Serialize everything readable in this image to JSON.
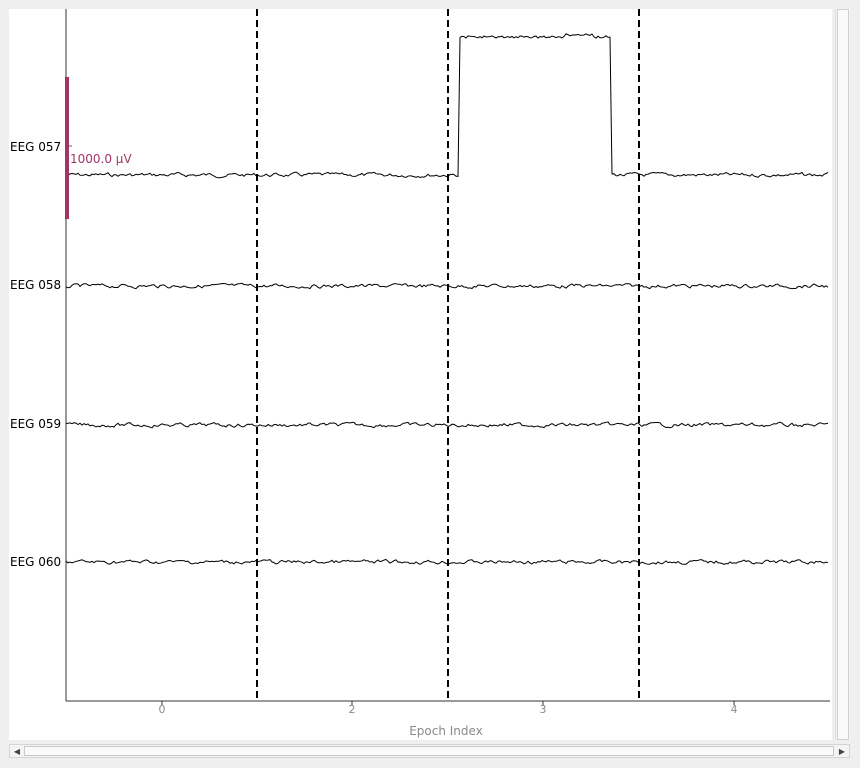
{
  "channels": [
    {
      "label": "EEG 057",
      "has_artifact": true
    },
    {
      "label": "EEG 058",
      "has_artifact": false
    },
    {
      "label": "EEG 059",
      "has_artifact": false
    },
    {
      "label": "EEG 060",
      "has_artifact": false
    }
  ],
  "epoch_ticks": [
    "0",
    "2",
    "3",
    "4"
  ],
  "x_axis_label": "Epoch Index",
  "scale_bar_label": "1000.0 µV",
  "colors": {
    "trace": "#000000",
    "scale_bar": "#a23566",
    "tick_label": "#8a8a8a",
    "epoch_boundary": "#000000"
  },
  "icons": {
    "scroll_left": "triangle-left-icon",
    "scroll_right": "triangle-right-icon"
  }
}
